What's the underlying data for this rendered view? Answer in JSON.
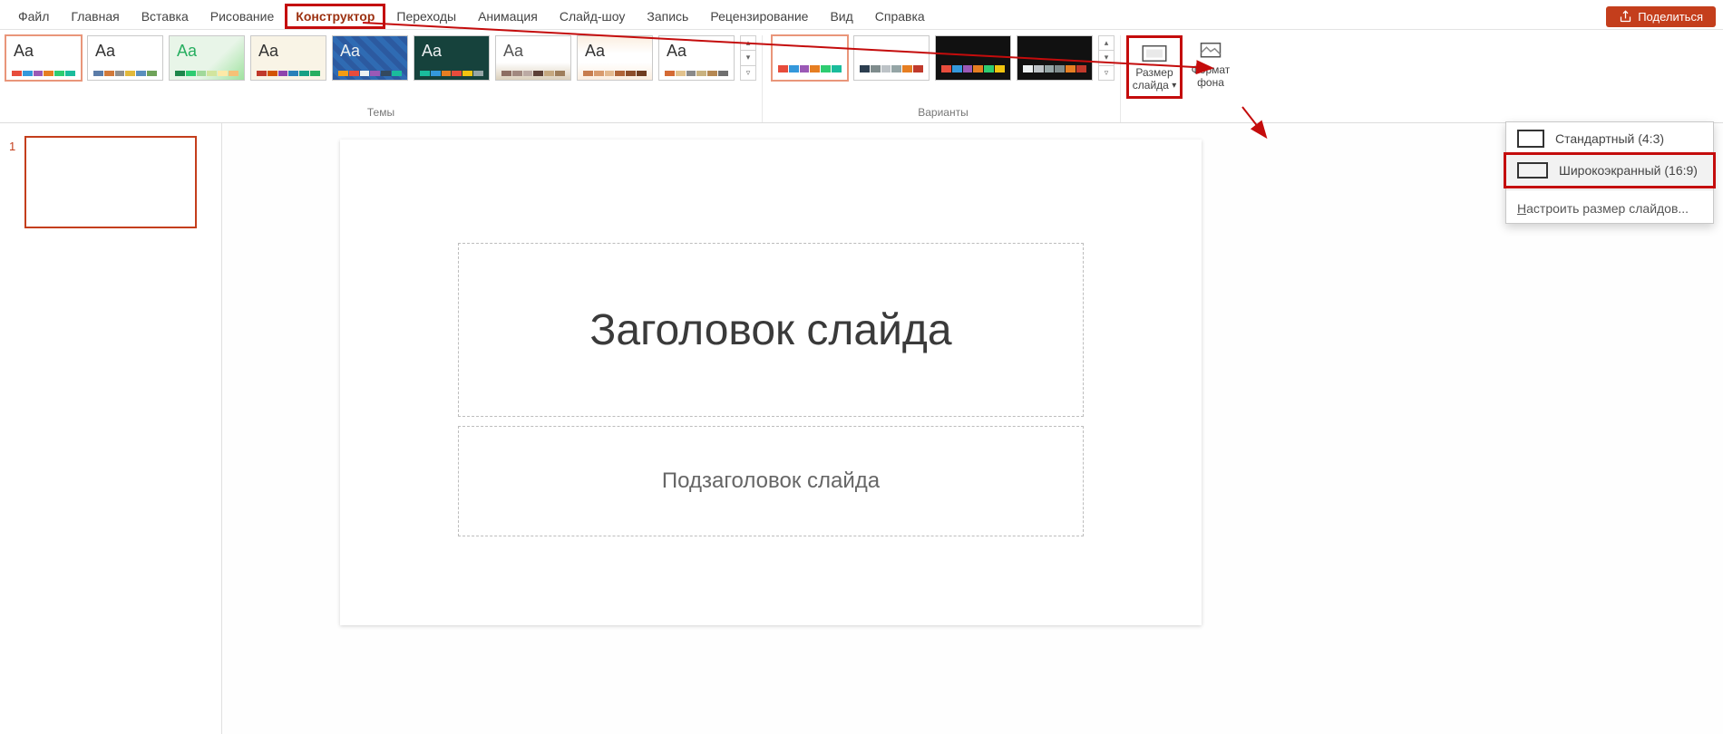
{
  "menu": {
    "items": [
      "Файл",
      "Главная",
      "Вставка",
      "Рисование",
      "Конструктор",
      "Переходы",
      "Анимация",
      "Слайд-шоу",
      "Запись",
      "Рецензирование",
      "Вид",
      "Справка"
    ],
    "active_index": 4
  },
  "share_label": "Поделиться",
  "ribbon": {
    "themes_label": "Темы",
    "variants_label": "Варианты",
    "slide_size": {
      "line1": "Размер",
      "line2": "слайда"
    },
    "bg_format": {
      "line1": "Формат",
      "line2": "фона"
    },
    "themes": [
      {
        "aa": "Aa",
        "aa_color": "#333",
        "bg": "#ffffff",
        "selected": true,
        "bars": [
          "#e74c3c",
          "#3498db",
          "#9b59b6",
          "#e67e22",
          "#2ecc71",
          "#1abc9c"
        ]
      },
      {
        "aa": "Aa",
        "aa_color": "#333",
        "bg": "#ffffff",
        "selected": false,
        "bars": [
          "#5b7ca8",
          "#d17a3b",
          "#8f8f8f",
          "#e2b93b",
          "#5a8fbd",
          "#6fa35a"
        ]
      },
      {
        "aa": "Aa",
        "aa_color": "#27ae60",
        "bg": "linear-gradient(135deg,#e8f5e8 60%,#9fe29f 100%)",
        "selected": false,
        "bars": [
          "#1e874b",
          "#2ecc71",
          "#a1d99b",
          "#d2e59e",
          "#fde9a7",
          "#f6c177"
        ]
      },
      {
        "aa": "Aa",
        "aa_color": "#333",
        "bg": "#f9f4e6",
        "selected": false,
        "bars": [
          "#c0392b",
          "#d35400",
          "#8e44ad",
          "#2980b9",
          "#16a085",
          "#27ae60"
        ]
      },
      {
        "aa": "Aa",
        "aa_color": "#ecf0f1",
        "bg": "repeating-linear-gradient(45deg,#2c5aa0 0 6px,#2f6bb3 6px 12px)",
        "selected": false,
        "bars": [
          "#f39c12",
          "#e74c3c",
          "#ecf0f1",
          "#9b59b6",
          "#34495e",
          "#1abc9c"
        ]
      },
      {
        "aa": "Aa",
        "aa_color": "#ecf0f1",
        "bg": "#16423c",
        "selected": false,
        "bars": [
          "#1abc9c",
          "#3498db",
          "#e67e22",
          "#e74c3c",
          "#f1c40f",
          "#95a5a6"
        ]
      },
      {
        "aa": "Aa",
        "aa_color": "#555",
        "bg": "linear-gradient(180deg,#fff 60%,#dcd0bc 100%)",
        "selected": false,
        "bars": [
          "#8d6e63",
          "#a1887f",
          "#bcaaa4",
          "#5d4037",
          "#c5a880",
          "#9e7e5b"
        ]
      },
      {
        "aa": "Aa",
        "aa_color": "#333",
        "bg": "linear-gradient(180deg,#fbeee0 0,#fff 40%,#fff 60%,#fbeee0 100%)",
        "selected": false,
        "bars": [
          "#c77d4f",
          "#d89b6e",
          "#e3b98f",
          "#b06438",
          "#8c4d2a",
          "#6f3c20"
        ]
      },
      {
        "aa": "Aa",
        "aa_color": "#333",
        "bg": "#ffffff",
        "selected": false,
        "bars": [
          "#d46a34",
          "#e2c28d",
          "#8a8a8a",
          "#c9b280",
          "#b58853",
          "#6f6f6f"
        ]
      }
    ],
    "variants": [
      {
        "bg": "#ffffff",
        "selected": true,
        "bars": [
          "#e74c3c",
          "#3498db",
          "#9b59b6",
          "#e67e22",
          "#2ecc71",
          "#1abc9c"
        ]
      },
      {
        "bg": "#ffffff",
        "selected": false,
        "bars": [
          "#2c3e50",
          "#7f8c8d",
          "#bdc3c7",
          "#95a5a6",
          "#e67e22",
          "#c0392b"
        ]
      },
      {
        "bg": "#111111",
        "selected": false,
        "bars": [
          "#e74c3c",
          "#3498db",
          "#9b59b6",
          "#e67e22",
          "#2ecc71",
          "#f1c40f"
        ]
      },
      {
        "bg": "#111111",
        "selected": false,
        "bars": [
          "#ecf0f1",
          "#bdc3c7",
          "#95a5a6",
          "#7f8c8d",
          "#e67e22",
          "#c0392b"
        ]
      }
    ]
  },
  "slide_panel": {
    "number": "1"
  },
  "slide": {
    "title_placeholder": "Заголовок слайда",
    "subtitle_placeholder": "Подзаголовок слайда"
  },
  "size_menu": {
    "standard": "Стандартный (4:3)",
    "widescreen": "Широкоэкранный (16:9)",
    "custom_prefix": "Н",
    "custom_rest": "астроить размер слайдов..."
  }
}
